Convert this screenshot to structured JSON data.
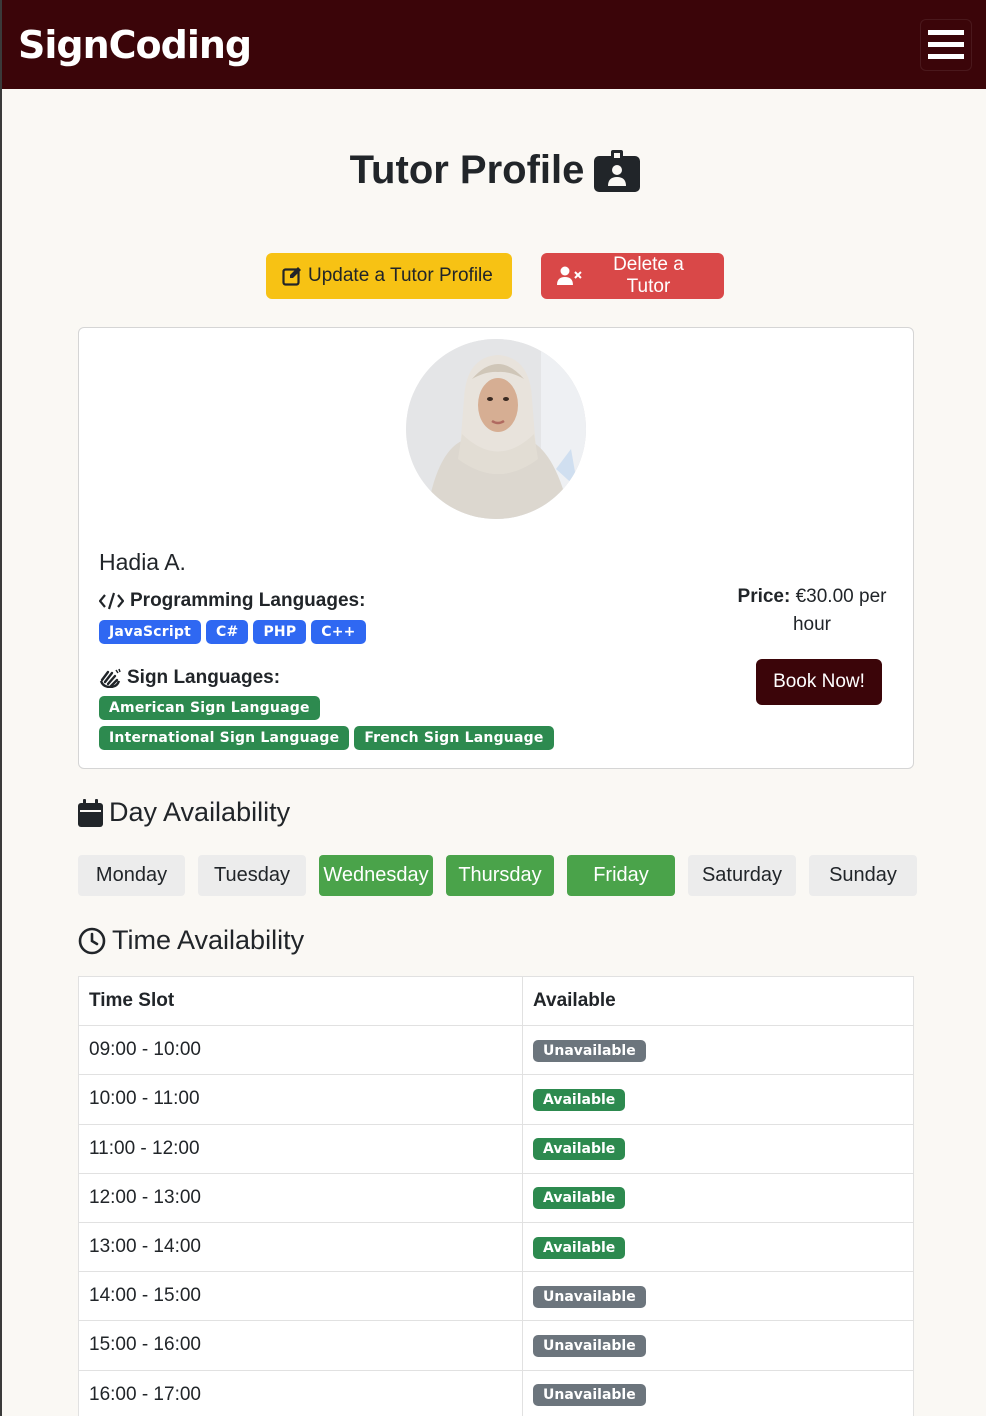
{
  "navbar": {
    "brand": "SignCoding"
  },
  "page": {
    "title": "Tutor Profile"
  },
  "actions": {
    "update_label": "Update a Tutor Profile",
    "delete_label": "Delete a Tutor"
  },
  "tutor": {
    "name": "Hadia A.",
    "programming_heading": "Programming Languages:",
    "programming_languages": [
      "JavaScript",
      "C#",
      "PHP",
      "C++"
    ],
    "sign_heading": "Sign Languages:",
    "sign_languages": [
      "American Sign Language",
      "International Sign Language",
      "French Sign Language"
    ],
    "price_label": "Price:",
    "price_value": "€30.00 per hour",
    "book_label": "Book Now!"
  },
  "days_section": {
    "title": "Day Availability",
    "days": [
      {
        "label": "Monday",
        "available": false
      },
      {
        "label": "Tuesday",
        "available": false
      },
      {
        "label": "Wednesday",
        "available": true
      },
      {
        "label": "Thursday",
        "available": true
      },
      {
        "label": "Friday",
        "available": true
      },
      {
        "label": "Saturday",
        "available": false
      },
      {
        "label": "Sunday",
        "available": false
      }
    ]
  },
  "time_section": {
    "title": "Time Availability",
    "headers": [
      "Time Slot",
      "Available"
    ],
    "rows": [
      {
        "slot": "09:00 - 10:00",
        "status": "Unavailable"
      },
      {
        "slot": "10:00 - 11:00",
        "status": "Available"
      },
      {
        "slot": "11:00 - 12:00",
        "status": "Available"
      },
      {
        "slot": "12:00 - 13:00",
        "status": "Available"
      },
      {
        "slot": "13:00 - 14:00",
        "status": "Available"
      },
      {
        "slot": "14:00 - 15:00",
        "status": "Unavailable"
      },
      {
        "slot": "15:00 - 16:00",
        "status": "Unavailable"
      },
      {
        "slot": "16:00 - 17:00",
        "status": "Unavailable"
      }
    ]
  },
  "colors": {
    "brand": "#3b0509",
    "warning": "#f7c214",
    "danger": "#d94848",
    "primary_badge": "#2f68f2",
    "success": "#2d8a4f",
    "day_on": "#4aa34a"
  }
}
